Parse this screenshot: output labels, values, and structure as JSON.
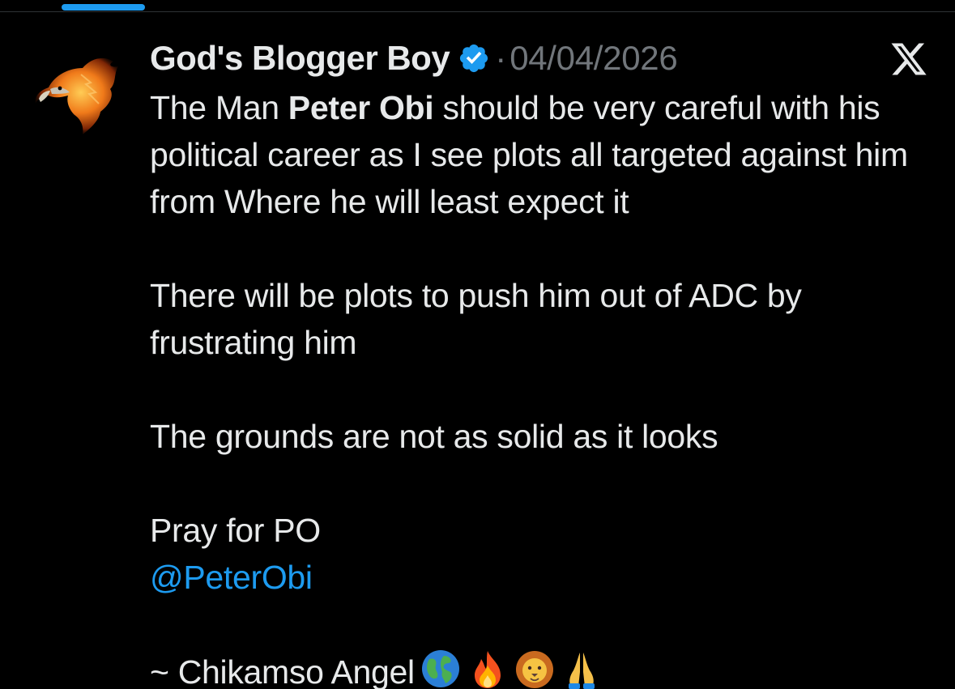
{
  "tweet": {
    "display_name": "God's Blogger Boy",
    "separator": "·",
    "date": "04/04/2026",
    "text": {
      "p1_before": "The Man ",
      "p1_bold": "Peter Obi",
      "p1_after": " should be very careful with his political career as I see plots all targeted against him from Where he will least expect it",
      "p2": "There will be plots to push him out of ADC by frustrating him",
      "p3": "The grounds are not as solid as it looks",
      "p4": "Pray for PO",
      "mention": "@PeterObi",
      "signature": "~ Chikamso Angel"
    },
    "emojis": [
      "globe-emoji",
      "fire-emoji",
      "lion-emoji",
      "praying-hands-emoji"
    ]
  },
  "colors": {
    "background": "#000000",
    "text": "#e7e9ea",
    "muted": "#71767b",
    "accent": "#1d9bf0"
  },
  "icons": {
    "verified": "verified-badge-icon",
    "brand": "x-logo-icon"
  }
}
